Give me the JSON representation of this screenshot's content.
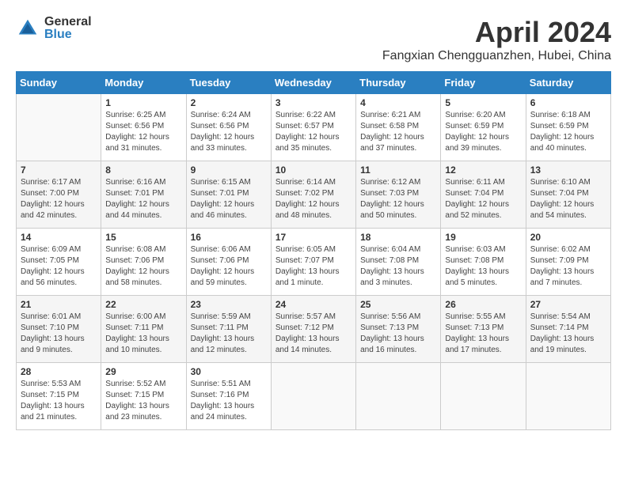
{
  "header": {
    "logo": {
      "general": "General",
      "blue": "Blue"
    },
    "title": "April 2024",
    "location": "Fangxian Chengguanzhen, Hubei, China"
  },
  "days_of_week": [
    "Sunday",
    "Monday",
    "Tuesday",
    "Wednesday",
    "Thursday",
    "Friday",
    "Saturday"
  ],
  "weeks": [
    [
      {
        "day": "",
        "info": ""
      },
      {
        "day": "1",
        "info": "Sunrise: 6:25 AM\nSunset: 6:56 PM\nDaylight: 12 hours\nand 31 minutes."
      },
      {
        "day": "2",
        "info": "Sunrise: 6:24 AM\nSunset: 6:56 PM\nDaylight: 12 hours\nand 33 minutes."
      },
      {
        "day": "3",
        "info": "Sunrise: 6:22 AM\nSunset: 6:57 PM\nDaylight: 12 hours\nand 35 minutes."
      },
      {
        "day": "4",
        "info": "Sunrise: 6:21 AM\nSunset: 6:58 PM\nDaylight: 12 hours\nand 37 minutes."
      },
      {
        "day": "5",
        "info": "Sunrise: 6:20 AM\nSunset: 6:59 PM\nDaylight: 12 hours\nand 39 minutes."
      },
      {
        "day": "6",
        "info": "Sunrise: 6:18 AM\nSunset: 6:59 PM\nDaylight: 12 hours\nand 40 minutes."
      }
    ],
    [
      {
        "day": "7",
        "info": "Sunrise: 6:17 AM\nSunset: 7:00 PM\nDaylight: 12 hours\nand 42 minutes."
      },
      {
        "day": "8",
        "info": "Sunrise: 6:16 AM\nSunset: 7:01 PM\nDaylight: 12 hours\nand 44 minutes."
      },
      {
        "day": "9",
        "info": "Sunrise: 6:15 AM\nSunset: 7:01 PM\nDaylight: 12 hours\nand 46 minutes."
      },
      {
        "day": "10",
        "info": "Sunrise: 6:14 AM\nSunset: 7:02 PM\nDaylight: 12 hours\nand 48 minutes."
      },
      {
        "day": "11",
        "info": "Sunrise: 6:12 AM\nSunset: 7:03 PM\nDaylight: 12 hours\nand 50 minutes."
      },
      {
        "day": "12",
        "info": "Sunrise: 6:11 AM\nSunset: 7:04 PM\nDaylight: 12 hours\nand 52 minutes."
      },
      {
        "day": "13",
        "info": "Sunrise: 6:10 AM\nSunset: 7:04 PM\nDaylight: 12 hours\nand 54 minutes."
      }
    ],
    [
      {
        "day": "14",
        "info": "Sunrise: 6:09 AM\nSunset: 7:05 PM\nDaylight: 12 hours\nand 56 minutes."
      },
      {
        "day": "15",
        "info": "Sunrise: 6:08 AM\nSunset: 7:06 PM\nDaylight: 12 hours\nand 58 minutes."
      },
      {
        "day": "16",
        "info": "Sunrise: 6:06 AM\nSunset: 7:06 PM\nDaylight: 12 hours\nand 59 minutes."
      },
      {
        "day": "17",
        "info": "Sunrise: 6:05 AM\nSunset: 7:07 PM\nDaylight: 13 hours\nand 1 minute."
      },
      {
        "day": "18",
        "info": "Sunrise: 6:04 AM\nSunset: 7:08 PM\nDaylight: 13 hours\nand 3 minutes."
      },
      {
        "day": "19",
        "info": "Sunrise: 6:03 AM\nSunset: 7:08 PM\nDaylight: 13 hours\nand 5 minutes."
      },
      {
        "day": "20",
        "info": "Sunrise: 6:02 AM\nSunset: 7:09 PM\nDaylight: 13 hours\nand 7 minutes."
      }
    ],
    [
      {
        "day": "21",
        "info": "Sunrise: 6:01 AM\nSunset: 7:10 PM\nDaylight: 13 hours\nand 9 minutes."
      },
      {
        "day": "22",
        "info": "Sunrise: 6:00 AM\nSunset: 7:11 PM\nDaylight: 13 hours\nand 10 minutes."
      },
      {
        "day": "23",
        "info": "Sunrise: 5:59 AM\nSunset: 7:11 PM\nDaylight: 13 hours\nand 12 minutes."
      },
      {
        "day": "24",
        "info": "Sunrise: 5:57 AM\nSunset: 7:12 PM\nDaylight: 13 hours\nand 14 minutes."
      },
      {
        "day": "25",
        "info": "Sunrise: 5:56 AM\nSunset: 7:13 PM\nDaylight: 13 hours\nand 16 minutes."
      },
      {
        "day": "26",
        "info": "Sunrise: 5:55 AM\nSunset: 7:13 PM\nDaylight: 13 hours\nand 17 minutes."
      },
      {
        "day": "27",
        "info": "Sunrise: 5:54 AM\nSunset: 7:14 PM\nDaylight: 13 hours\nand 19 minutes."
      }
    ],
    [
      {
        "day": "28",
        "info": "Sunrise: 5:53 AM\nSunset: 7:15 PM\nDaylight: 13 hours\nand 21 minutes."
      },
      {
        "day": "29",
        "info": "Sunrise: 5:52 AM\nSunset: 7:15 PM\nDaylight: 13 hours\nand 23 minutes."
      },
      {
        "day": "30",
        "info": "Sunrise: 5:51 AM\nSunset: 7:16 PM\nDaylight: 13 hours\nand 24 minutes."
      },
      {
        "day": "",
        "info": ""
      },
      {
        "day": "",
        "info": ""
      },
      {
        "day": "",
        "info": ""
      },
      {
        "day": "",
        "info": ""
      }
    ]
  ]
}
